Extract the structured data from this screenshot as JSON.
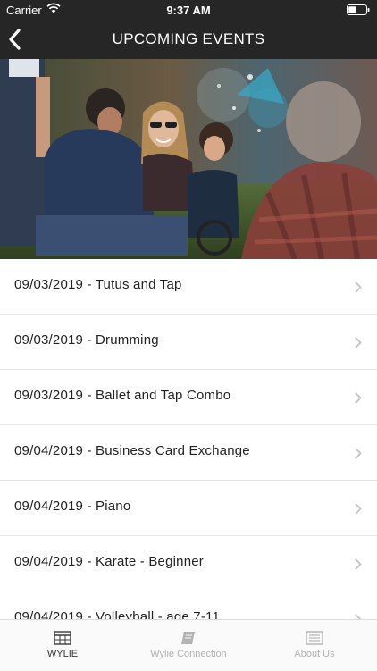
{
  "status_bar": {
    "carrier": "Carrier",
    "time": "9:37 AM",
    "wifi_icon": "wifi-icon",
    "battery_icon": "battery-icon"
  },
  "nav": {
    "title": "UPCOMING EVENTS",
    "back_icon": "chevron-left-icon"
  },
  "colors": {
    "header_bg": "#262626",
    "tab_active": "#3a3a3a",
    "tab_inactive": "#b3b3b3"
  },
  "hero": {
    "description_icon": "photo-people-picnic"
  },
  "events": [
    {
      "label": "09/03/2019 - Tutus and Tap"
    },
    {
      "label": "09/03/2019 - Drumming"
    },
    {
      "label": "09/03/2019 - Ballet and Tap Combo"
    },
    {
      "label": "09/04/2019 - Business Card Exchange"
    },
    {
      "label": "09/04/2019 - Piano"
    },
    {
      "label": "09/04/2019 - Karate - Beginner"
    },
    {
      "label": "09/04/2019 - Volleyball - age 7-11"
    }
  ],
  "tabbar": {
    "tabs": [
      {
        "label": "WYLIE",
        "icon": "calendar-grid-icon",
        "active": true
      },
      {
        "label": "Wylie Connection",
        "icon": "book-icon",
        "active": false
      },
      {
        "label": "About Us",
        "icon": "newspaper-icon",
        "active": false
      }
    ]
  }
}
